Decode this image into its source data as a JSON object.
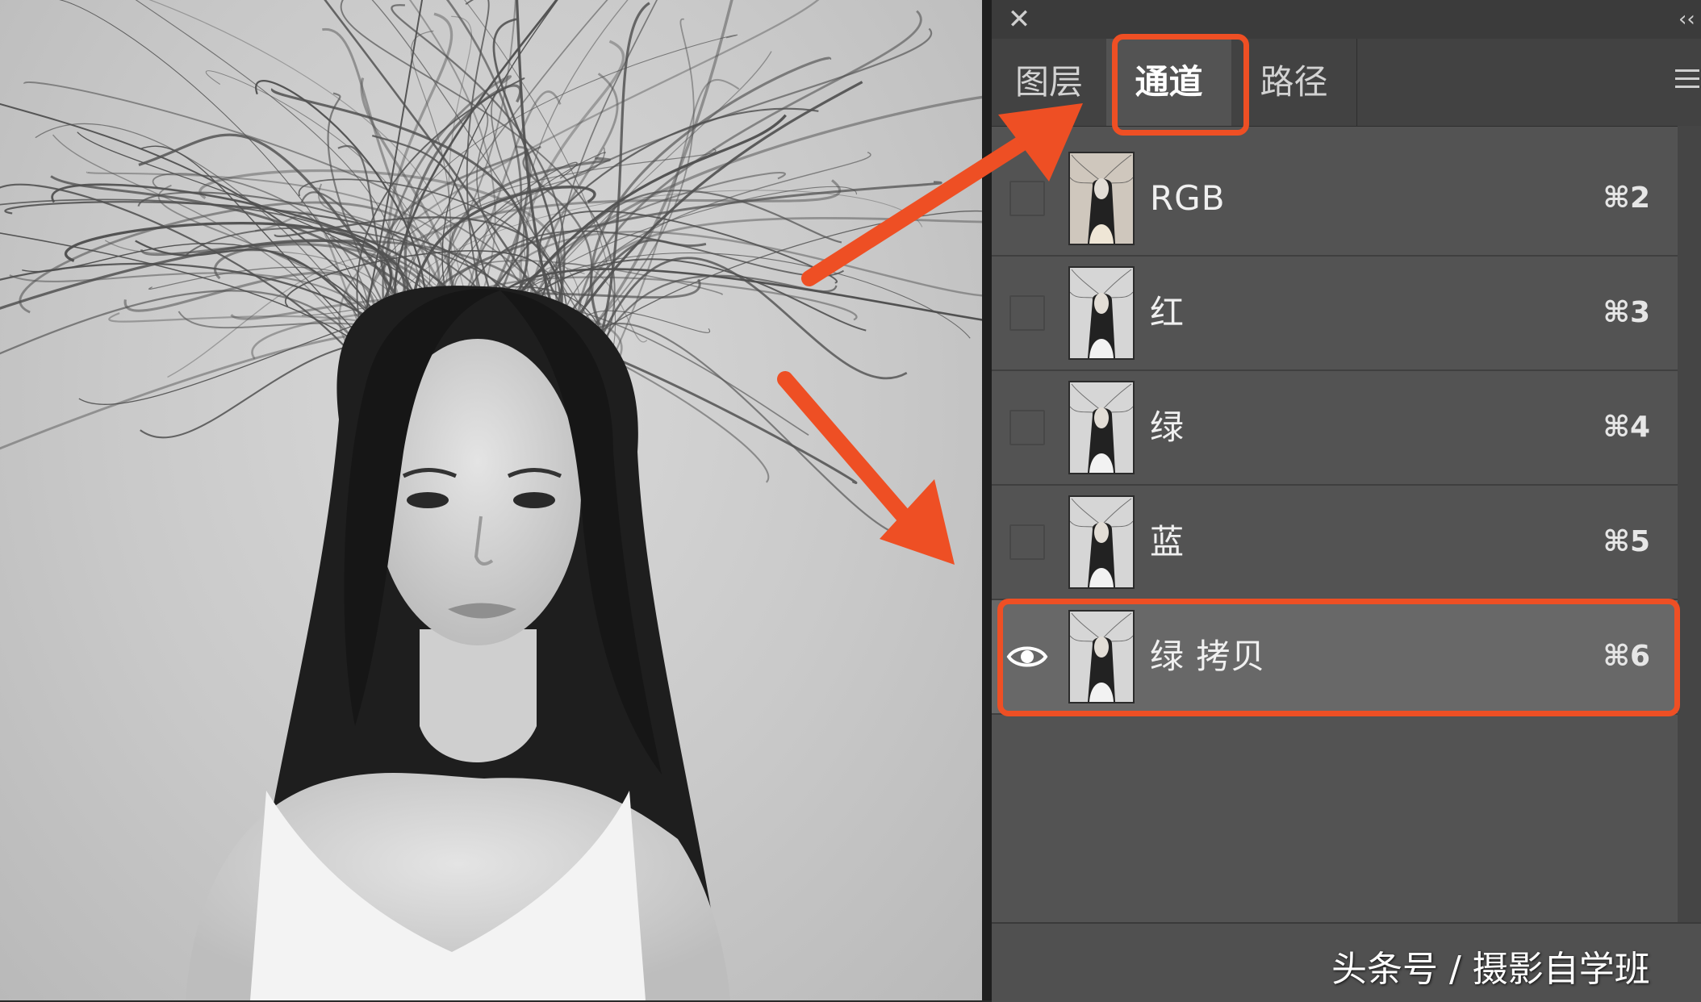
{
  "panel": {
    "close_glyph": "✕",
    "collapse_glyph": "‹‹",
    "tabs": [
      {
        "label": "图层"
      },
      {
        "label": "通道"
      },
      {
        "label": "路径"
      }
    ],
    "selected_tab": "通道",
    "channels": [
      {
        "name": "RGB",
        "shortcut": "⌘2",
        "visible": false
      },
      {
        "name": "红",
        "shortcut": "⌘3",
        "visible": false
      },
      {
        "name": "绿",
        "shortcut": "⌘4",
        "visible": false
      },
      {
        "name": "蓝",
        "shortcut": "⌘5",
        "visible": false
      },
      {
        "name": "绿 拷贝",
        "shortcut": "⌘6",
        "visible": true
      }
    ]
  },
  "watermark": "头条号 / 摄影自学班",
  "colors": {
    "highlight": "#ee4f24",
    "panel_bg": "#535353",
    "active_row": "#686868",
    "tabbar_bg": "#424242"
  }
}
